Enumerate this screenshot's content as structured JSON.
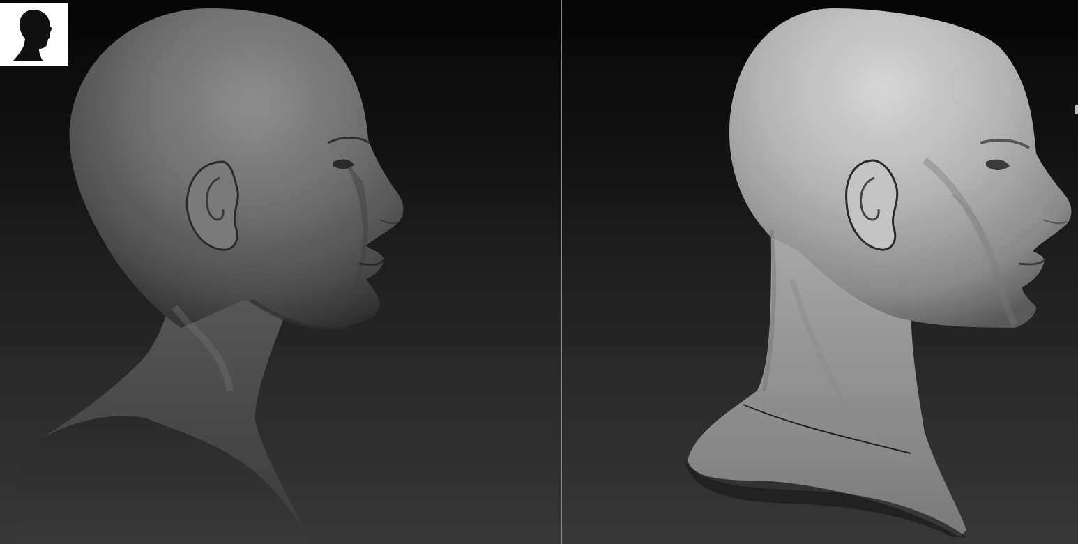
{
  "viewport": {
    "left_panel": {
      "model": "head-profile-smooth",
      "material": "matcap-gray"
    },
    "right_panel": {
      "model": "head-profile-detailed",
      "material": "matcap-light-gray"
    }
  },
  "thumbnail": {
    "icon": "head-silhouette-icon"
  },
  "colors": {
    "background_top": "#050505",
    "background_bottom": "#373737",
    "divider": "#8a8a8a",
    "thumbnail_bg": "#ffffff"
  }
}
